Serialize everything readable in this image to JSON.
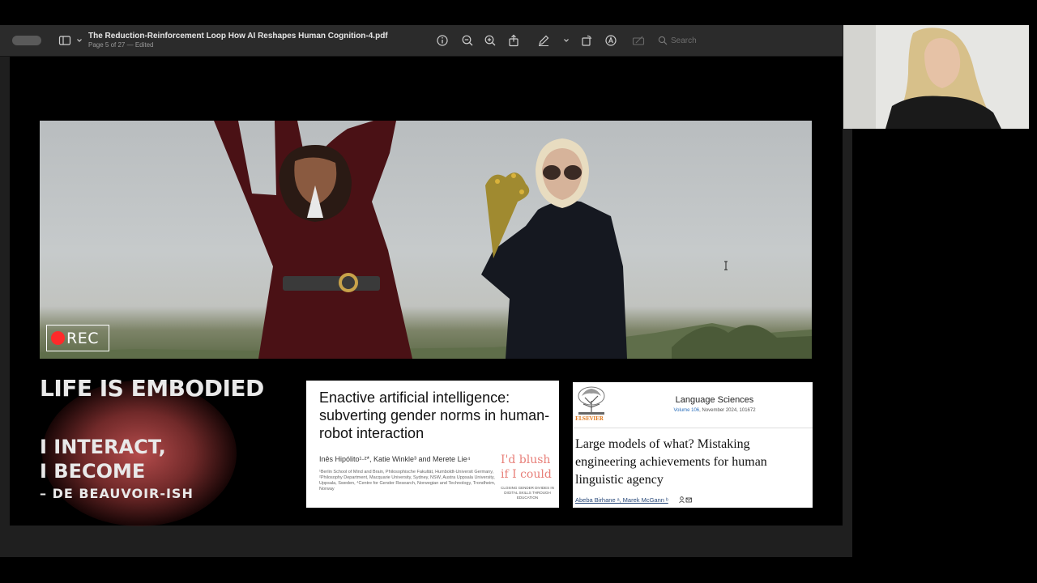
{
  "window": {
    "doc_title": "The Reduction-Reinforcement Loop How AI Reshapes Human Cognition-4.pdf",
    "doc_subtitle": "Page 5 of 27 — Edited",
    "search_placeholder": "Search"
  },
  "toolbar": {
    "icons": [
      "sidebar-icon",
      "chevron-down-icon",
      "info-icon",
      "zoom-out-icon",
      "zoom-in-icon",
      "share-icon",
      "markup-pen-icon",
      "chevron-down-icon",
      "rotate-icon",
      "markup-icon",
      "form-fill-icon",
      "search-icon"
    ]
  },
  "slide": {
    "rec_label": "REC",
    "headline_1": "LIFE IS EMBODIED",
    "headline_2": "I INTERACT,",
    "headline_3": "I BECOME",
    "headline_4": "– DE BEAUVOIR-ISH",
    "card_a": {
      "title": "Enactive artificial intelligence: subverting gender norms in human-robot interaction",
      "authors": "Inês Hipólito¹·²*, Katie Winkle³ and Merete Lie⁴",
      "affiliation": "¹Berlin School of Mind and Brain, Philosophische Fakultät, Humboldt-Universit Germany, ²Philosophy Department, Macquarie University, Sydney, NSW, Austra Uppsala University, Uppsala, Sweden, ⁴Centre for Gender Research, Norwegian and Technology, Trondheim, Norway",
      "blush_line_1": "I'd blush",
      "blush_line_2": "if I could",
      "blush_caption": "Closing gender divides in digital skills through education"
    },
    "card_b": {
      "publisher": "ELSEVIER",
      "journal": "Language Sciences",
      "volume": "Volume 106",
      "issue_info": ", November 2024, 101672",
      "title": "Large models of what? Mistaking engineering achievements for human linguistic agency",
      "authors": "Abeba Birhane ᵃ, Marek McGann ᵇ"
    }
  },
  "colors": {
    "accent_red": "#ff2a2a",
    "glow": "#b84a4a",
    "elsevier_orange": "#e07b22"
  }
}
